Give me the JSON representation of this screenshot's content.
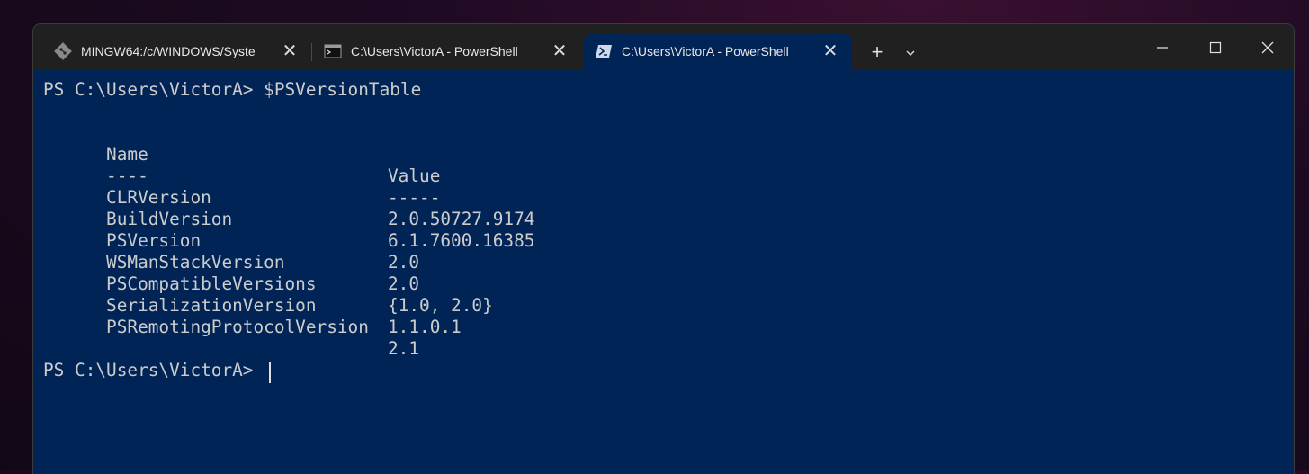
{
  "tabs": [
    {
      "label": "MINGW64:/c/WINDOWS/Syste",
      "icon": "git-icon",
      "active": false
    },
    {
      "label": "C:\\Users\\VictorA - PowerShell",
      "icon": "console-icon",
      "active": false
    },
    {
      "label": "C:\\Users\\VictorA - PowerShell",
      "icon": "powershell-icon",
      "active": true
    }
  ],
  "close_glyph": "✕",
  "new_tab_glyph": "+",
  "console": {
    "prompt1": "PS C:\\Users\\VictorA> $PSVersionTable",
    "header_name": "Name",
    "header_value": "Value",
    "underline_name": "----",
    "underline_value": "-----",
    "rows": [
      {
        "name": "CLRVersion",
        "value": "2.0.50727.9174"
      },
      {
        "name": "BuildVersion",
        "value": "6.1.7600.16385"
      },
      {
        "name": "PSVersion",
        "value": "2.0"
      },
      {
        "name": "WSManStackVersion",
        "value": "2.0"
      },
      {
        "name": "PSCompatibleVersions",
        "value": "{1.0, 2.0}"
      },
      {
        "name": "SerializationVersion",
        "value": "1.1.0.1"
      },
      {
        "name": "PSRemotingProtocolVersion",
        "value": "2.1"
      }
    ],
    "prompt2": "PS C:\\Users\\VictorA> "
  },
  "colors": {
    "console_bg": "#012456",
    "titlebar_bg": "#202020",
    "text": "#cccccc"
  }
}
